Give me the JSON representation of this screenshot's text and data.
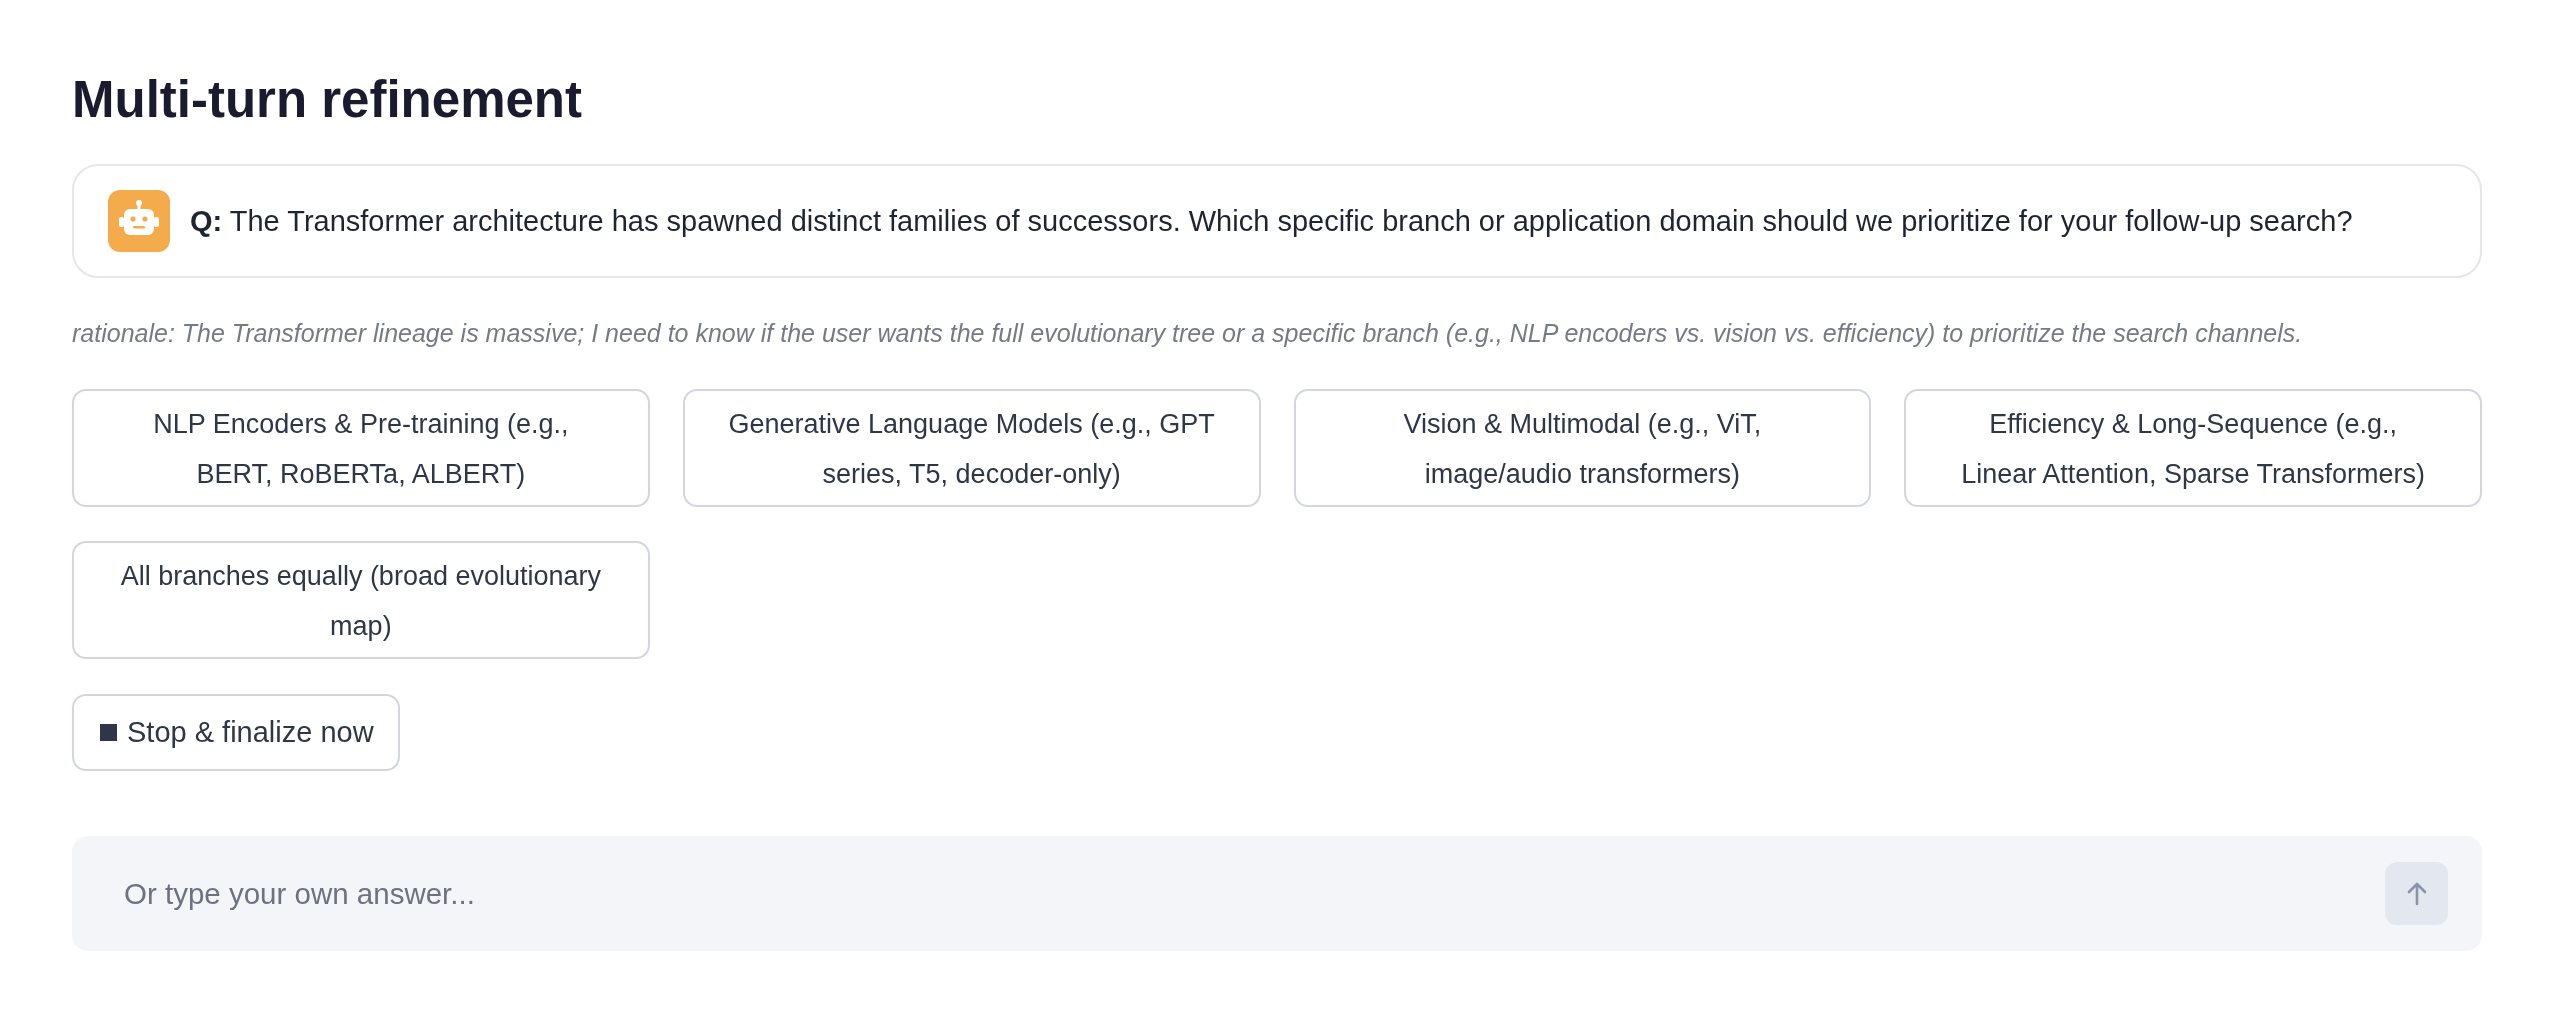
{
  "heading": "Multi-turn refinement",
  "question": {
    "text": "**Q:** The Transformer architecture has spawned distinct families of successors. Which specific branch or application domain should we prioritize for your follow-up search?"
  },
  "rationale": "rationale: The Transformer lineage is massive; I need to know if the user wants the full evolutionary tree or a specific branch (e.g., NLP encoders vs. vision vs. efficiency) to prioritize the search channels.",
  "options": [
    {
      "label": "NLP Encoders & Pre-training (e.g., BERT, RoBERTa, ALBERT)"
    },
    {
      "label": "Generative Language Models (e.g., GPT series, T5, decoder-only)"
    },
    {
      "label": "Vision & Multimodal (e.g., ViT, image/audio transformers)"
    },
    {
      "label": "Efficiency & Long-Sequence (e.g., Linear Attention, Sparse Transformers)"
    },
    {
      "label": "All branches equally (broad evolutionary map)"
    }
  ],
  "stop_button": {
    "label": "Stop & finalize now"
  },
  "answer_field": {
    "placeholder": "Or type your own answer..."
  }
}
